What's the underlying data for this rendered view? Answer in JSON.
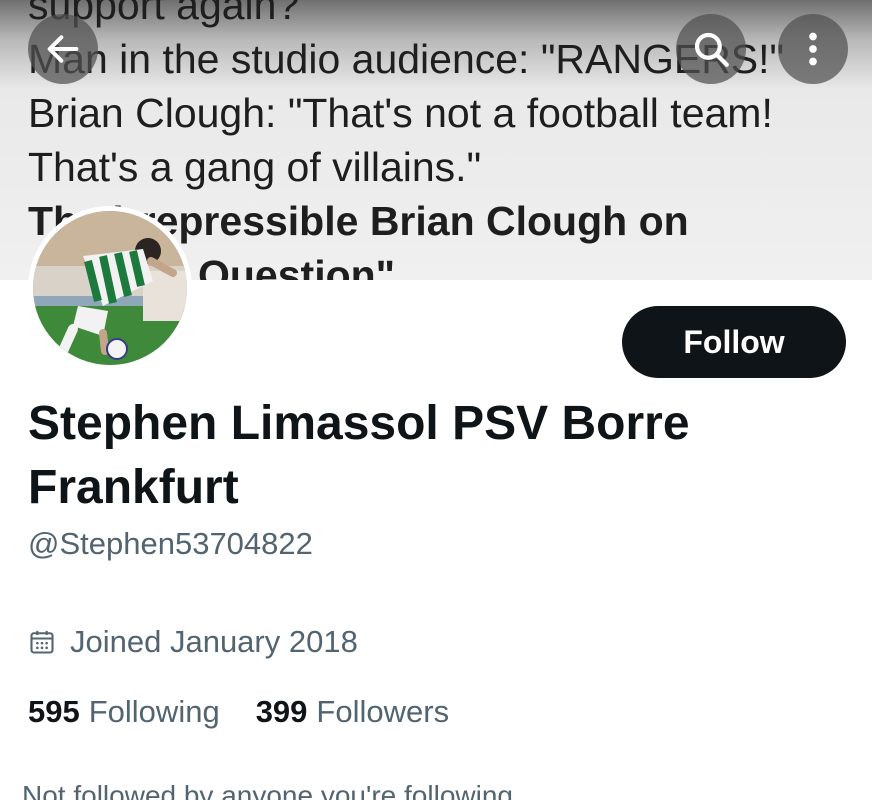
{
  "banner": {
    "lines": [
      "support again?",
      "Man in the studio audience: \"RANGERS!\"",
      "Brian Clough: \"That's not a football team!",
      "That's a gang of villains.\"",
      "The irrepressible Brian Clough on",
      "Question\""
    ]
  },
  "icons": {
    "back": "back-arrow-icon",
    "search": "search-icon",
    "more": "more-vertical-icon",
    "calendar": "calendar-icon"
  },
  "profile": {
    "follow_label": "Follow",
    "display_name": "Stephen Limassol PSV Borre Frankfurt",
    "handle": "@Stephen53704822",
    "joined": "Joined January 2018",
    "following_count": "595",
    "following_label": "Following",
    "followers_count": "399",
    "followers_label": "Followers",
    "not_followed": "Not followed by anyone you're following"
  },
  "colors": {
    "follow_bg": "#0f1419",
    "secondary_text": "#536471"
  }
}
